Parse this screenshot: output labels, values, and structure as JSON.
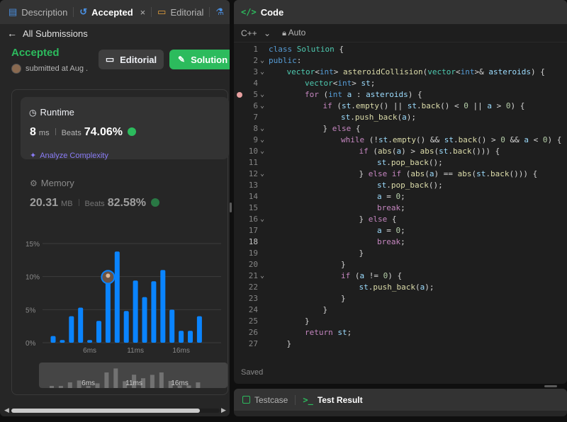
{
  "left_panel": {
    "tabs": [
      {
        "label": "Description",
        "icon": "document-icon"
      },
      {
        "label": "Accepted",
        "icon": "history-icon",
        "close": "×"
      },
      {
        "label": "Editorial",
        "icon": "book-icon"
      },
      {
        "label": "",
        "icon": "flask-icon"
      }
    ],
    "back_label": "All Submissions",
    "status": "Accepted",
    "submitted_text": "submitted at Aug .",
    "editorial_button": "Editorial",
    "solution_button": "Solution",
    "runtime": {
      "label": "Runtime",
      "value": "8",
      "unit": "ms",
      "beats_label": "Beats",
      "beats_pct": "74.06%",
      "analyze": "Analyze Complexity"
    },
    "memory": {
      "label": "Memory",
      "value": "20.31",
      "unit": "MB",
      "beats_label": "Beats",
      "beats_pct": "82.58%"
    }
  },
  "chart_data": {
    "type": "bar",
    "ylim": [
      0,
      15
    ],
    "yticks": [
      "15%",
      "10%",
      "5%",
      "0%"
    ],
    "xticks": [
      "6ms",
      "11ms",
      "16ms"
    ],
    "bar_ms": [
      2,
      3,
      4,
      5,
      6,
      7,
      8,
      9,
      10,
      11,
      12,
      13,
      14,
      15,
      16,
      17,
      18
    ],
    "values": [
      1.0,
      0.4,
      4.0,
      5.3,
      0.4,
      3.3,
      11.0,
      13.8,
      4.8,
      9.4,
      6.9,
      9.3,
      11.0,
      5.0,
      1.8,
      1.8,
      4.0
    ],
    "highlight_ms": 8,
    "grid": true
  },
  "mini_chart": {
    "xticks": [
      "6ms",
      "11ms",
      "16ms"
    ]
  },
  "code_panel": {
    "title": "Code",
    "language": "C++",
    "mode": "Auto",
    "status": "Saved",
    "current_line": 18,
    "breakpoint_line": 5,
    "lines": [
      {
        "n": "1",
        "fold": false,
        "indent": 0,
        "html": "<span class='kw'>class</span> <span class='ty'>Solution</span> {"
      },
      {
        "n": "2",
        "fold": true,
        "indent": 0,
        "html": "<span class='kw'>public</span>:"
      },
      {
        "n": "3",
        "fold": true,
        "indent": 1,
        "html": "<span class='ty'>vector</span>&lt;<span class='kw'>int</span>&gt; <span class='fn'>asteroidCollision</span>(<span class='ty'>vector</span>&lt;<span class='kw'>int</span>&gt;&amp; <span class='va'>asteroids</span>) {"
      },
      {
        "n": "4",
        "fold": false,
        "indent": 2,
        "html": "<span class='ty'>vector</span>&lt;<span class='kw'>int</span>&gt; <span class='va'>st</span>;"
      },
      {
        "n": "5",
        "fold": true,
        "indent": 2,
        "html": "<span class='ct'>for</span> (<span class='kw'>int</span> <span class='va'>a</span> : <span class='va'>asteroids</span>) {"
      },
      {
        "n": "6",
        "fold": true,
        "indent": 3,
        "html": "<span class='ct'>if</span> (<span class='va'>st</span>.<span class='fn'>empty</span>() || <span class='va'>st</span>.<span class='fn'>back</span>() &lt; <span class='nm'>0</span> || <span class='va'>a</span> &gt; <span class='nm'>0</span>) {"
      },
      {
        "n": "7",
        "fold": false,
        "indent": 4,
        "html": "<span class='va'>st</span>.<span class='fn'>push_back</span>(<span class='va'>a</span>);"
      },
      {
        "n": "8",
        "fold": true,
        "indent": 3,
        "html": "} <span class='ct'>else</span> {"
      },
      {
        "n": "9",
        "fold": true,
        "indent": 4,
        "html": "<span class='ct'>while</span> (!<span class='va'>st</span>.<span class='fn'>empty</span>() &amp;&amp; <span class='va'>st</span>.<span class='fn'>back</span>() &gt; <span class='nm'>0</span> &amp;&amp; <span class='va'>a</span> &lt; <span class='nm'>0</span>) {"
      },
      {
        "n": "10",
        "fold": true,
        "indent": 5,
        "html": "<span class='ct'>if</span> (<span class='fn'>abs</span>(<span class='va'>a</span>) &gt; <span class='fn'>abs</span>(<span class='va'>st</span>.<span class='fn'>back</span>())) {"
      },
      {
        "n": "11",
        "fold": false,
        "indent": 6,
        "html": "<span class='va'>st</span>.<span class='fn'>pop_back</span>();"
      },
      {
        "n": "12",
        "fold": true,
        "indent": 5,
        "html": "} <span class='ct'>else if</span> (<span class='fn'>abs</span>(<span class='va'>a</span>) == <span class='fn'>abs</span>(<span class='va'>st</span>.<span class='fn'>back</span>())) {"
      },
      {
        "n": "13",
        "fold": false,
        "indent": 6,
        "html": "<span class='va'>st</span>.<span class='fn'>pop_back</span>();"
      },
      {
        "n": "14",
        "fold": false,
        "indent": 6,
        "html": "<span class='va'>a</span> = <span class='nm'>0</span>;"
      },
      {
        "n": "15",
        "fold": false,
        "indent": 6,
        "html": "<span class='ct'>break</span>;"
      },
      {
        "n": "16",
        "fold": true,
        "indent": 5,
        "html": "} <span class='ct'>else</span> {"
      },
      {
        "n": "17",
        "fold": false,
        "indent": 6,
        "html": "<span class='va'>a</span> = <span class='nm'>0</span>;"
      },
      {
        "n": "18",
        "fold": false,
        "indent": 6,
        "html": "<span class='ct'>break</span>;"
      },
      {
        "n": "19",
        "fold": false,
        "indent": 5,
        "html": "}"
      },
      {
        "n": "20",
        "fold": false,
        "indent": 4,
        "html": "}"
      },
      {
        "n": "21",
        "fold": true,
        "indent": 4,
        "html": "<span class='ct'>if</span> (<span class='va'>a</span> != <span class='nm'>0</span>) {"
      },
      {
        "n": "22",
        "fold": false,
        "indent": 5,
        "html": "<span class='va'>st</span>.<span class='fn'>push_back</span>(<span class='va'>a</span>);"
      },
      {
        "n": "23",
        "fold": false,
        "indent": 4,
        "html": "}"
      },
      {
        "n": "24",
        "fold": false,
        "indent": 3,
        "html": "}"
      },
      {
        "n": "25",
        "fold": false,
        "indent": 2,
        "html": "}"
      },
      {
        "n": "26",
        "fold": false,
        "indent": 2,
        "html": "<span class='ct'>return</span> <span class='va'>st</span>;"
      },
      {
        "n": "27",
        "fold": false,
        "indent": 1,
        "html": "}"
      }
    ]
  },
  "bottom_panel": {
    "testcase": "Testcase",
    "test_result": "Test Result"
  },
  "colors": {
    "accent_green": "#2cbb5d",
    "bar_blue": "#0a84ff",
    "analyze_purple": "#8a7cf6"
  }
}
